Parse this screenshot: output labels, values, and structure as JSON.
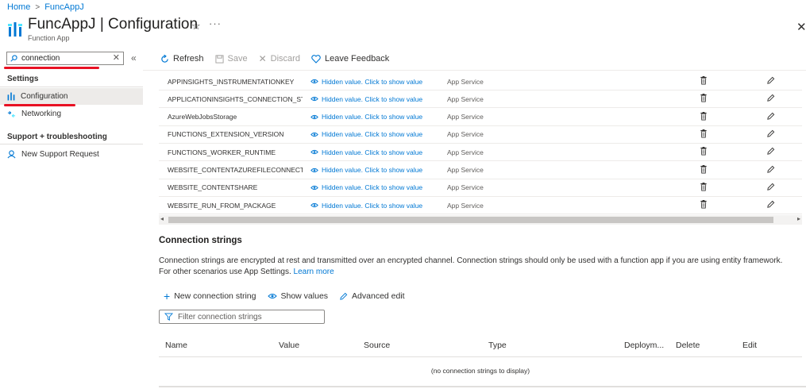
{
  "breadcrumb": {
    "home": "Home",
    "current": "FuncAppJ"
  },
  "header": {
    "title": "FuncAppJ | Configuration",
    "subtitle": "Function App",
    "star": "☆",
    "more": "···",
    "close": "✕"
  },
  "sidebar": {
    "search_value": "connection",
    "collapse": "«",
    "sections": [
      {
        "title": "Settings",
        "items": [
          {
            "label": "Configuration",
            "icon": "configuration-icon",
            "selected": true
          },
          {
            "label": "Networking",
            "icon": "networking-icon"
          }
        ]
      },
      {
        "title": "Support + troubleshooting",
        "items": [
          {
            "label": "New Support Request",
            "icon": "support-icon"
          }
        ]
      }
    ]
  },
  "toolbar": {
    "refresh": "Refresh",
    "save": "Save",
    "discard": "Discard",
    "feedback": "Leave Feedback"
  },
  "app_settings": {
    "hidden_text": "Hidden value. Click to show value",
    "rows": [
      {
        "name": "APPINSIGHTS_INSTRUMENTATIONKEY",
        "source": "App Service"
      },
      {
        "name": "APPLICATIONINSIGHTS_CONNECTION_STRIN",
        "source": "App Service"
      },
      {
        "name": "AzureWebJobsStorage",
        "source": "App Service"
      },
      {
        "name": "FUNCTIONS_EXTENSION_VERSION",
        "source": "App Service"
      },
      {
        "name": "FUNCTIONS_WORKER_RUNTIME",
        "source": "App Service"
      },
      {
        "name": "WEBSITE_CONTENTAZUREFILECONNECTIONS",
        "source": "App Service"
      },
      {
        "name": "WEBSITE_CONTENTSHARE",
        "source": "App Service"
      },
      {
        "name": "WEBSITE_RUN_FROM_PACKAGE",
        "source": "App Service"
      }
    ]
  },
  "connection_strings": {
    "title": "Connection strings",
    "description": "Connection strings are encrypted at rest and transmitted over an encrypted channel. Connection strings should only be used with a function app if you are using entity framework. For other scenarios use App Settings.",
    "learn_more": "Learn more",
    "new_label": "New connection string",
    "show_values": "Show values",
    "advanced_edit": "Advanced edit",
    "filter_placeholder": "Filter connection strings",
    "columns": {
      "name": "Name",
      "value": "Value",
      "source": "Source",
      "type": "Type",
      "deployment": "Deploym...",
      "delete": "Delete",
      "edit": "Edit"
    },
    "empty_text": "(no connection strings to display)"
  },
  "colors": {
    "accent": "#0078d4",
    "annotation": "#e81123"
  }
}
